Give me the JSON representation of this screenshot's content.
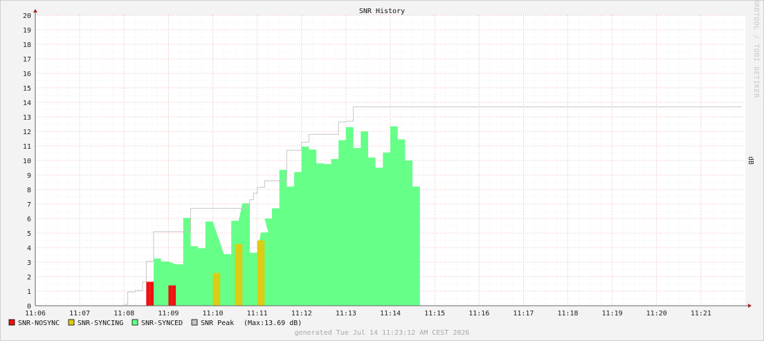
{
  "chart_data": {
    "type": "area",
    "title": "SNR History",
    "ylabel": "dB",
    "ylim": [
      0,
      20
    ],
    "yticks": [
      "0",
      "1",
      "2",
      "3",
      "4",
      "5",
      "6",
      "7",
      "8",
      "9",
      "10",
      "11",
      "12",
      "13",
      "14",
      "15",
      "16",
      "17",
      "18",
      "19",
      "20"
    ],
    "xlim": [
      "11:06:00",
      "11:22:00"
    ],
    "xticks": [
      "11:06",
      "11:07",
      "11:08",
      "11:09",
      "11:10",
      "11:11",
      "11:12",
      "11:13",
      "11:14",
      "11:15",
      "11:16",
      "11:17",
      "11:18",
      "11:19",
      "11:20",
      "11:21"
    ],
    "grid": true,
    "legend_placement": "bottom-left",
    "series": [
      {
        "name": "SNR-NOSYNC",
        "color": "#ee1111",
        "x": [
          "11:08:30",
          "11:08:35",
          "11:08:40",
          "11:08:45",
          "11:08:50",
          "11:08:55",
          "11:09:00",
          "11:09:05",
          "11:09:10"
        ],
        "values": [
          1.65,
          1.65,
          0,
          0,
          0,
          0,
          1.4,
          1.4,
          0
        ]
      },
      {
        "name": "SNR-SYNCING",
        "color": "#ddcc11",
        "x": [
          "11:10:00",
          "11:10:05",
          "11:10:10",
          "11:10:15",
          "11:10:20",
          "11:10:25",
          "11:10:30",
          "11:10:35",
          "11:10:40",
          "11:10:45",
          "11:10:50",
          "11:10:55",
          "11:11:00",
          "11:11:05"
        ],
        "values": [
          2.25,
          2.25,
          0,
          0,
          0,
          0,
          4.25,
          4.25,
          0,
          0,
          0,
          0,
          4.5,
          4.5
        ]
      },
      {
        "name": "SNR-SYNCED",
        "color": "#66ff88",
        "x": [
          "11:08:40",
          "11:08:50",
          "11:09:10",
          "11:09:20",
          "11:09:30",
          "11:09:40",
          "11:09:50",
          "11:10:15",
          "11:10:25",
          "11:10:40",
          "11:10:50",
          "11:11:05",
          "11:11:10",
          "11:11:20",
          "11:11:30",
          "11:11:40",
          "11:11:50",
          "11:12:00",
          "11:12:10",
          "11:12:20",
          "11:12:30",
          "11:12:40",
          "11:12:50",
          "11:13:00",
          "11:13:10",
          "11:13:20",
          "11:13:30",
          "11:13:40",
          "11:13:50",
          "11:14:00",
          "11:14:10",
          "11:14:20",
          "11:14:30",
          "11:14:40"
        ],
        "values": [
          3.25,
          3.05,
          2.85,
          6.05,
          4.1,
          3.95,
          5.8,
          3.55,
          5.85,
          7.05,
          3.65,
          5.05,
          6.0,
          6.7,
          9.35,
          8.2,
          9.2,
          10.95,
          10.75,
          9.8,
          9.75,
          10.1,
          11.4,
          12.3,
          10.85,
          12.0,
          10.2,
          9.5,
          10.55,
          12.35,
          11.45,
          10.0,
          8.2,
          0
        ]
      },
      {
        "name": "SNR Peak",
        "color": "#c4c4c4",
        "max_label": "(Max:13.69 dB)",
        "x": [
          "11:08:00",
          "11:08:05",
          "11:08:15",
          "11:08:25",
          "11:08:30",
          "11:08:40",
          "11:09:20",
          "11:09:30",
          "11:10:40",
          "11:10:45",
          "11:10:50",
          "11:10:55",
          "11:11:00",
          "11:11:10",
          "11:11:20",
          "11:11:30",
          "11:11:40",
          "11:11:50",
          "11:12:00",
          "11:12:10",
          "11:12:20",
          "11:12:50",
          "11:13:00",
          "11:13:10",
          "11:14:00",
          "11:21:55"
        ],
        "values": [
          0.1,
          0.95,
          1.05,
          1.65,
          3.05,
          5.1,
          5.1,
          6.7,
          6.7,
          6.95,
          7.3,
          7.75,
          8.15,
          8.6,
          8.6,
          8.6,
          10.7,
          10.7,
          11.25,
          11.8,
          11.8,
          12.65,
          12.7,
          13.69,
          13.69,
          13.69
        ]
      }
    ]
  },
  "watermark": "RRDTOOL / TOBI OETIKER",
  "footer": "generated Tue Jul 14 11:23:12 AM CEST 2026"
}
